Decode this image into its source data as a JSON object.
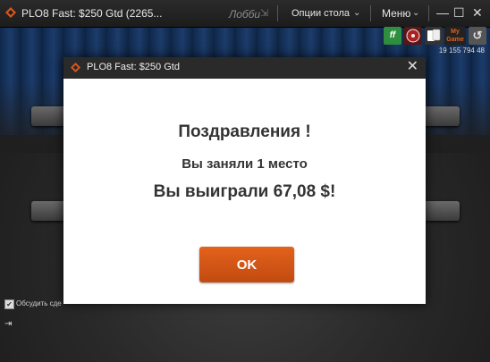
{
  "window": {
    "title": "PLO8 Fast: $250 Gtd (2265...",
    "lobby_label": "Лобби",
    "table_options_label": "Опции стола",
    "menu_label": "Меню",
    "controls": {
      "minimize": "—",
      "maximize": "☐",
      "close": "✕"
    }
  },
  "table": {
    "balance": "19 155 794 48",
    "icons": {
      "ff": "ff",
      "my_game": "My Game"
    },
    "chat_option_label": "Обсудить сде",
    "chat_checked": "✔"
  },
  "dialog": {
    "title": "PLO8 Fast: $250 Gtd",
    "close_glyph": "✕",
    "heading": "Поздравления !",
    "place_text": "Вы заняли 1 место",
    "win_text": "Вы выиграли 67,08 $!",
    "ok_label": "OK"
  },
  "colors": {
    "accent_orange": "#d9561a",
    "ff_green": "#3aa34a",
    "titlebar": "#222222"
  }
}
